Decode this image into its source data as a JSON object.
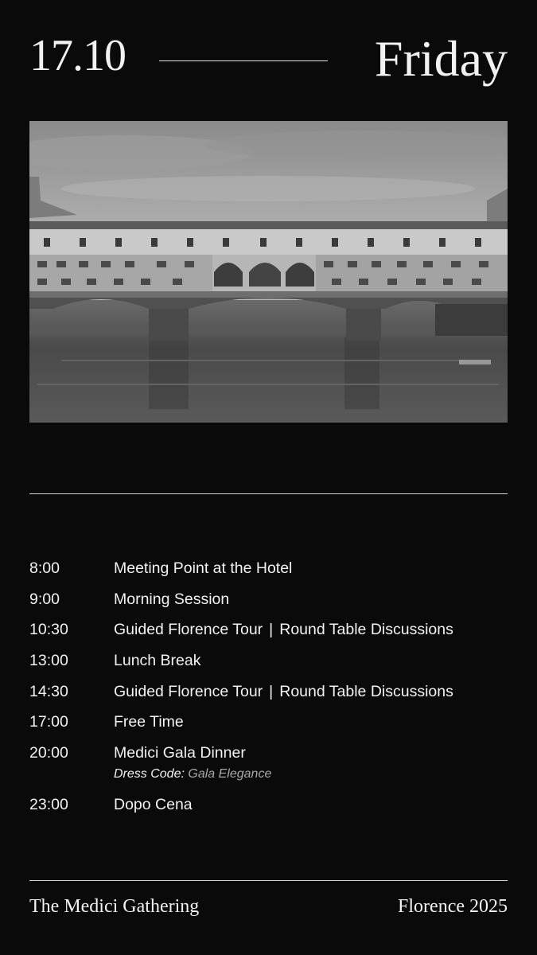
{
  "header": {
    "date": "17.10",
    "weekday": "Friday"
  },
  "photo": {
    "subject": "bridge-over-river"
  },
  "schedule": [
    {
      "time": "8:00",
      "title": "Meeting Point at the Hotel"
    },
    {
      "time": "9:00",
      "title": "Morning Session"
    },
    {
      "time": "10:30",
      "title": "Guided Florence Tour",
      "separator": "|",
      "title_alt": "Round Table Discussions"
    },
    {
      "time": "13:00",
      "title": "Lunch Break"
    },
    {
      "time": "14:30",
      "title": "Guided Florence Tour",
      "separator": "|",
      "title_alt": "Round Table Discussions"
    },
    {
      "time": "17:00",
      "title": "Free Time"
    },
    {
      "time": "20:00",
      "title": "Medici Gala Dinner",
      "note_label": "Dress Code:",
      "note_value": "Gala Elegance"
    },
    {
      "time": "23:00",
      "title": "Dopo Cena"
    }
  ],
  "footer": {
    "event": "The Medici Gathering",
    "location_year": "Florence 2025"
  },
  "colors": {
    "background": "#0a0a0a",
    "text": "#f2f2f2",
    "muted": "#a8a8a8"
  }
}
